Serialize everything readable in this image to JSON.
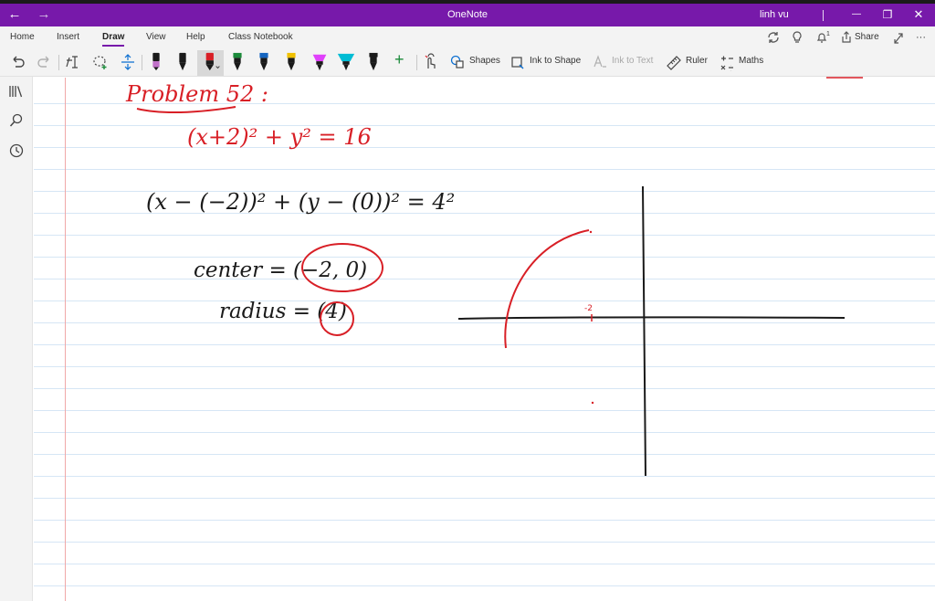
{
  "titlebar": {
    "app_title": "OneNote",
    "user_name": "linh vu",
    "back_glyph": "←",
    "forward_glyph": "→",
    "minimize_glyph": "—",
    "restore_glyph": "❐",
    "close_glyph": "✕",
    "background_color": "#7719aa"
  },
  "ribbon": {
    "tabs": [
      "Home",
      "Insert",
      "Draw",
      "View",
      "Help",
      "Class Notebook"
    ],
    "active_tab": "Draw",
    "notification_count": "1",
    "share_label": "Share",
    "more_glyph": "···"
  },
  "toolbar": {
    "shapes_label": "Shapes",
    "ink_to_shape_label": "Ink to Shape",
    "ink_to_text_label": "Ink to Text",
    "ruler_label": "Ruler",
    "maths_label": "Maths",
    "pens": [
      {
        "icon": "pen-icon",
        "color": "#c070c8"
      },
      {
        "icon": "pen-icon",
        "color": "#1a1a1a"
      },
      {
        "icon": "pen-icon",
        "color": "#d81f26",
        "selected": true
      },
      {
        "icon": "pen-icon",
        "color": "#1b8a3a"
      },
      {
        "icon": "pen-icon",
        "color": "#1565c0"
      },
      {
        "icon": "pen-icon",
        "color": "#f0c000"
      },
      {
        "icon": "highlighter-icon",
        "color": "#e040fb"
      },
      {
        "icon": "highlighter-icon",
        "color": "#00bcd4"
      },
      {
        "icon": "pen-icon",
        "color": "#1a1a1a"
      }
    ],
    "add_pen_glyph": "+"
  },
  "notes": {
    "line1": "Problem 52 :",
    "line2": "(x+2)² + y² = 16",
    "line3": "(x − (−2))² + (y − (0))² = 4²",
    "line4": "center = (−2, 0)",
    "line5": "radius = (4)",
    "graph_label": "-2",
    "ink_colors": {
      "red": "#d81f26",
      "black": "#1a1a1a"
    }
  }
}
